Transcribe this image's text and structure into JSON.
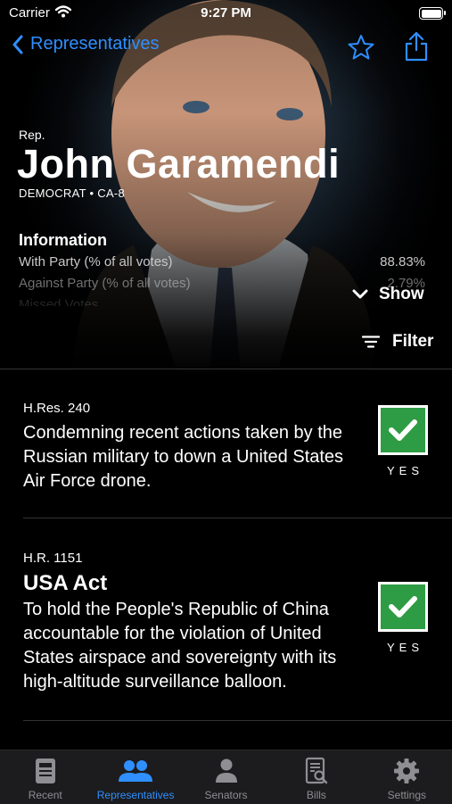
{
  "status_bar": {
    "carrier": "Carrier",
    "time": "9:27 PM"
  },
  "nav": {
    "back_label": "Representatives",
    "icons": [
      "star-icon",
      "share-icon"
    ]
  },
  "profile": {
    "prefix": "Rep.",
    "name": "John Garamendi",
    "party_district": "DEMOCRAT • CA-8"
  },
  "information": {
    "title": "Information",
    "rows": [
      {
        "label": "With Party (% of all votes)",
        "value": "88.83%"
      },
      {
        "label": "Against Party (% of all votes)",
        "value": "2.79%"
      },
      {
        "label": "Missed Votes",
        "value": ""
      }
    ],
    "show_label": "Show"
  },
  "filter_label": "Filter",
  "bills": [
    {
      "number": "H.Res. 240",
      "title": "",
      "description": "Condemning recent actions taken by the Russian military to down a United States Air Force drone.",
      "vote": "YES"
    },
    {
      "number": "H.R. 1151",
      "title": "USA Act",
      "description": "To hold the People's Republic of China accountable for the violation of United States airspace and sovereignty with its high-altitude surveillance balloon.",
      "vote": "YES"
    }
  ],
  "tabbar": {
    "tabs": [
      {
        "label": "Recent",
        "icon": "recent-icon",
        "active": false
      },
      {
        "label": "Representatives",
        "icon": "representatives-icon",
        "active": true
      },
      {
        "label": "Senators",
        "icon": "senators-icon",
        "active": false
      },
      {
        "label": "Bills",
        "icon": "bills-icon",
        "active": false
      },
      {
        "label": "Settings",
        "icon": "settings-icon",
        "active": false
      }
    ]
  },
  "colors": {
    "accent": "#2f8fff",
    "vote_yes": "#2e9c44",
    "tabbar_bg": "#1c1c1e"
  }
}
